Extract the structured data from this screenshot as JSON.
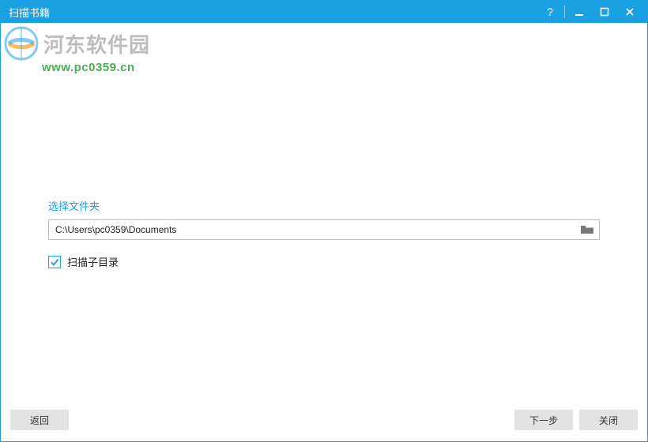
{
  "window": {
    "title": "扫描书籍"
  },
  "watermark": {
    "brand_text": "河东软件园",
    "url": "www.pc0359.cn"
  },
  "form": {
    "section_label": "选择文件夹",
    "path_value": "C:\\Users\\pc0359\\Documents",
    "checkbox_label": "扫描子目录",
    "checkbox_checked": true
  },
  "footer": {
    "back_label": "返回",
    "next_label": "下一步",
    "close_label": "关闭"
  },
  "colors": {
    "accent": "#1ba1e2",
    "button_bg": "#e3e3e3"
  }
}
